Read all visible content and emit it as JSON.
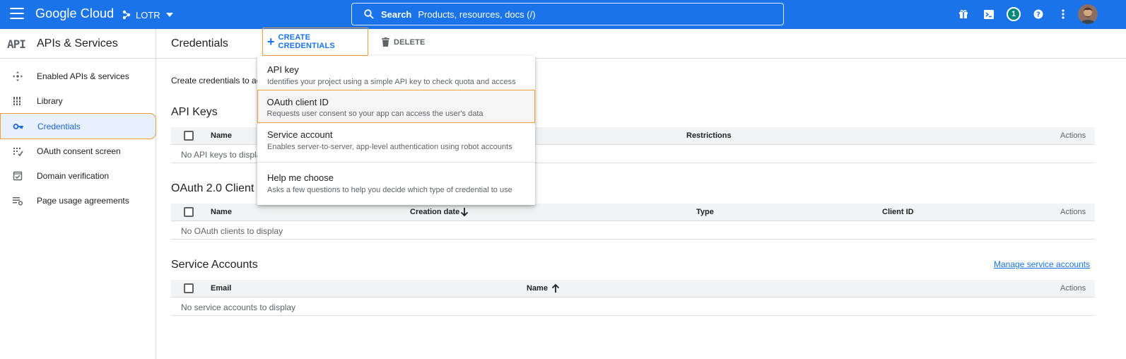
{
  "topbar": {
    "logo": "Google Cloud",
    "project": "LOTR",
    "search_label": "Search",
    "search_placeholder": "Products, resources, docs (/)",
    "notification_count": "1",
    "icons": [
      "menu-icon",
      "gift-icon",
      "cloud-shell-icon",
      "help-icon",
      "more-vert-icon"
    ]
  },
  "sidenav": {
    "badge": "API",
    "title": "APIs & Services",
    "items": [
      {
        "label": "Enabled APIs & services",
        "icon": "enabled-apis-icon"
      },
      {
        "label": "Library",
        "icon": "library-icon"
      },
      {
        "label": "Credentials",
        "icon": "key-icon",
        "active": true
      },
      {
        "label": "OAuth consent screen",
        "icon": "oauth-consent-icon"
      },
      {
        "label": "Domain verification",
        "icon": "domain-verification-icon"
      },
      {
        "label": "Page usage agreements",
        "icon": "page-usage-icon"
      }
    ]
  },
  "main": {
    "title": "Credentials",
    "create_label": "CREATE CREDENTIALS",
    "delete_label": "DELETE",
    "intro": "Create credentials to ac",
    "sections": {
      "api_keys": {
        "title": "API Keys",
        "columns": [
          "Name",
          "Restrictions",
          "Actions"
        ],
        "empty": "No API keys to displa"
      },
      "oauth": {
        "title": "OAuth 2.0 Client I",
        "columns": [
          "Name",
          "Creation date",
          "Type",
          "Client ID",
          "Actions"
        ],
        "empty": "No OAuth clients to display"
      },
      "service_accounts": {
        "title": "Service Accounts",
        "columns": [
          "Email",
          "Name",
          "Actions"
        ],
        "empty": "No service accounts to display",
        "manage_link": "Manage service accounts"
      }
    }
  },
  "dropdown": {
    "items": [
      {
        "title": "API key",
        "desc": "Identifies your project using a simple API key to check quota and access"
      },
      {
        "title": "OAuth client ID",
        "desc": "Requests user consent so your app can access the user's data",
        "highlighted": true
      },
      {
        "title": "Service account",
        "desc": "Enables server-to-server, app-level authentication using robot accounts"
      },
      {
        "title": "Help me choose",
        "desc": "Asks a few questions to help you decide which type of credential to use"
      }
    ]
  },
  "colors": {
    "brand_blue": "#1a73e8",
    "highlight_orange": "#f29d38",
    "badge_teal": "#00897b"
  }
}
